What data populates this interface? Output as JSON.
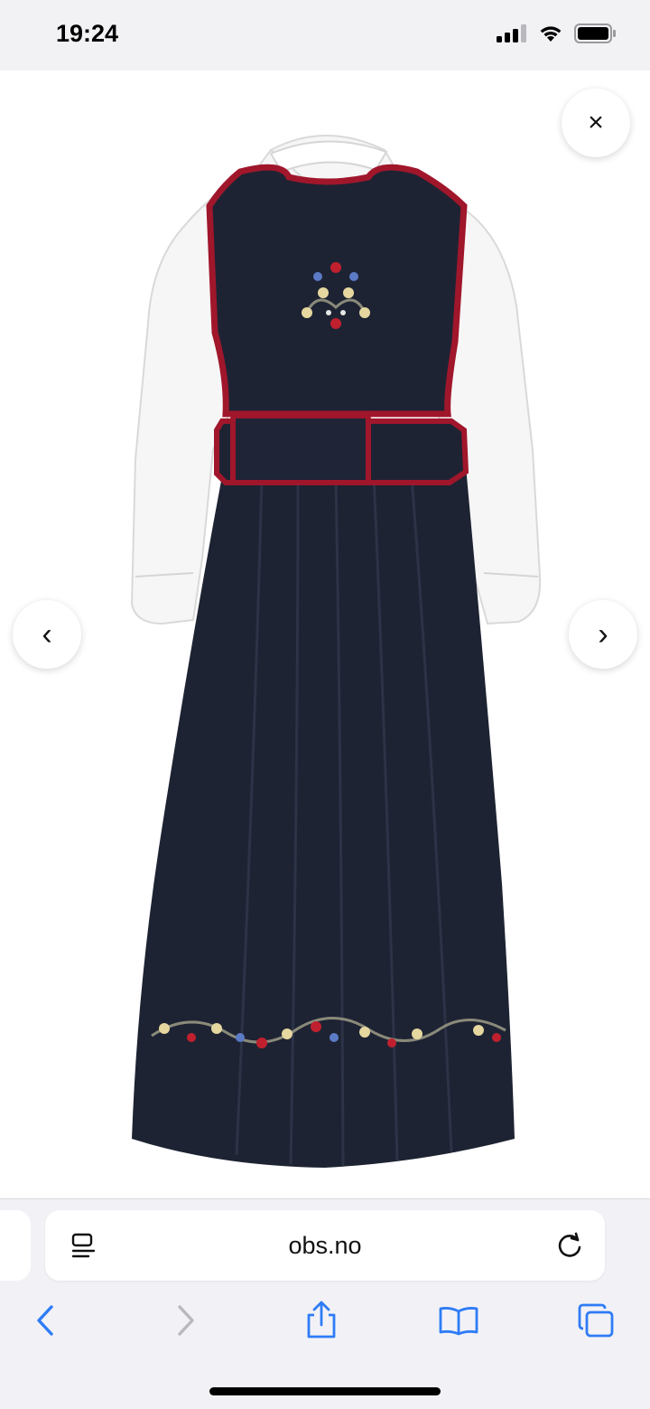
{
  "status_bar": {
    "time": "19:24"
  },
  "viewer": {
    "close_label": "×",
    "prev_label": "‹",
    "next_label": "›",
    "image_icon": "product-photo-dress"
  },
  "browser": {
    "url": "obs.no",
    "icons": {
      "reader": "reader-icon",
      "reload": "reload-icon",
      "back": "back-chevron-icon",
      "forward": "forward-chevron-icon",
      "share": "share-icon",
      "bookmarks": "book-icon",
      "tabs": "tabs-icon"
    }
  },
  "colors": {
    "accent": "#2f7cf6",
    "dress": "#1e2333",
    "trim": "#a0162b"
  }
}
